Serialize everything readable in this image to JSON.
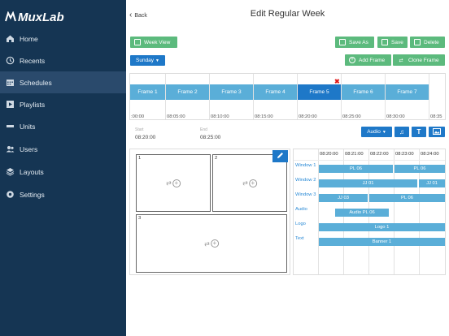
{
  "brand": {
    "name": "MuxLab"
  },
  "sidebar": {
    "items": [
      {
        "label": "Home",
        "icon": "home-icon"
      },
      {
        "label": "Recents",
        "icon": "history-icon"
      },
      {
        "label": "Schedules",
        "icon": "calendar-icon",
        "active": true
      },
      {
        "label": "Playlists",
        "icon": "playlist-icon"
      },
      {
        "label": "Units",
        "icon": "units-icon"
      },
      {
        "label": "Users",
        "icon": "users-icon"
      },
      {
        "label": "Layouts",
        "icon": "layers-icon"
      },
      {
        "label": "Settings",
        "icon": "gear-icon"
      }
    ]
  },
  "header": {
    "back_label": "Back",
    "title": "Edit Regular Week"
  },
  "toolbar": {
    "week_view": "Week View",
    "save_as": "Save As",
    "save": "Save",
    "delete": "Delete",
    "day_select": "Sunday",
    "add_frame": "Add Frame",
    "clone_frame": "Clone Frame"
  },
  "timeline": {
    "frames": [
      "Frame 1",
      "Frame 2",
      "Frame 3",
      "Frame 4",
      "Frame 5",
      "Frame 6",
      "Frame 7"
    ],
    "selected_frame": "Frame 5",
    "ticks": [
      ":00:00",
      "08:05:00",
      "08:10:00",
      "08:15:00",
      "08:20:00",
      "08:25:00",
      "08:30:00",
      "08:35"
    ]
  },
  "frame_info": {
    "start_label": "Start",
    "start_value": "08:20:00",
    "end_label": "End",
    "end_value": "08:25:00"
  },
  "media_tools": {
    "audio_select": "Audio",
    "text_tool": "T"
  },
  "layout": {
    "windows": [
      "1",
      "2",
      "3"
    ]
  },
  "grid": {
    "times": [
      "08:20:00",
      "08:21:00",
      "08:22:00",
      "08:23:00",
      "08:24:00"
    ],
    "rows": [
      "Window 1",
      "Window 2",
      "Window 3",
      "Audio",
      "Logo",
      "Text"
    ],
    "bars": {
      "w1a": "PL 06",
      "w1b": "PL 06",
      "w2a": "JJ 01",
      "w2b": "JJ 01",
      "w3a": "JJ 03",
      "w3b": "PL 06",
      "audio": "Audio PL 06",
      "logo": "Logo 1",
      "text": "Banner 1"
    }
  },
  "colors": {
    "sidebar_bg": "#153553",
    "accent_green": "#5cba7d",
    "accent_blue": "#1e78c8",
    "frame_blue": "#5aaed8",
    "delete_red": "#e01b1b"
  }
}
